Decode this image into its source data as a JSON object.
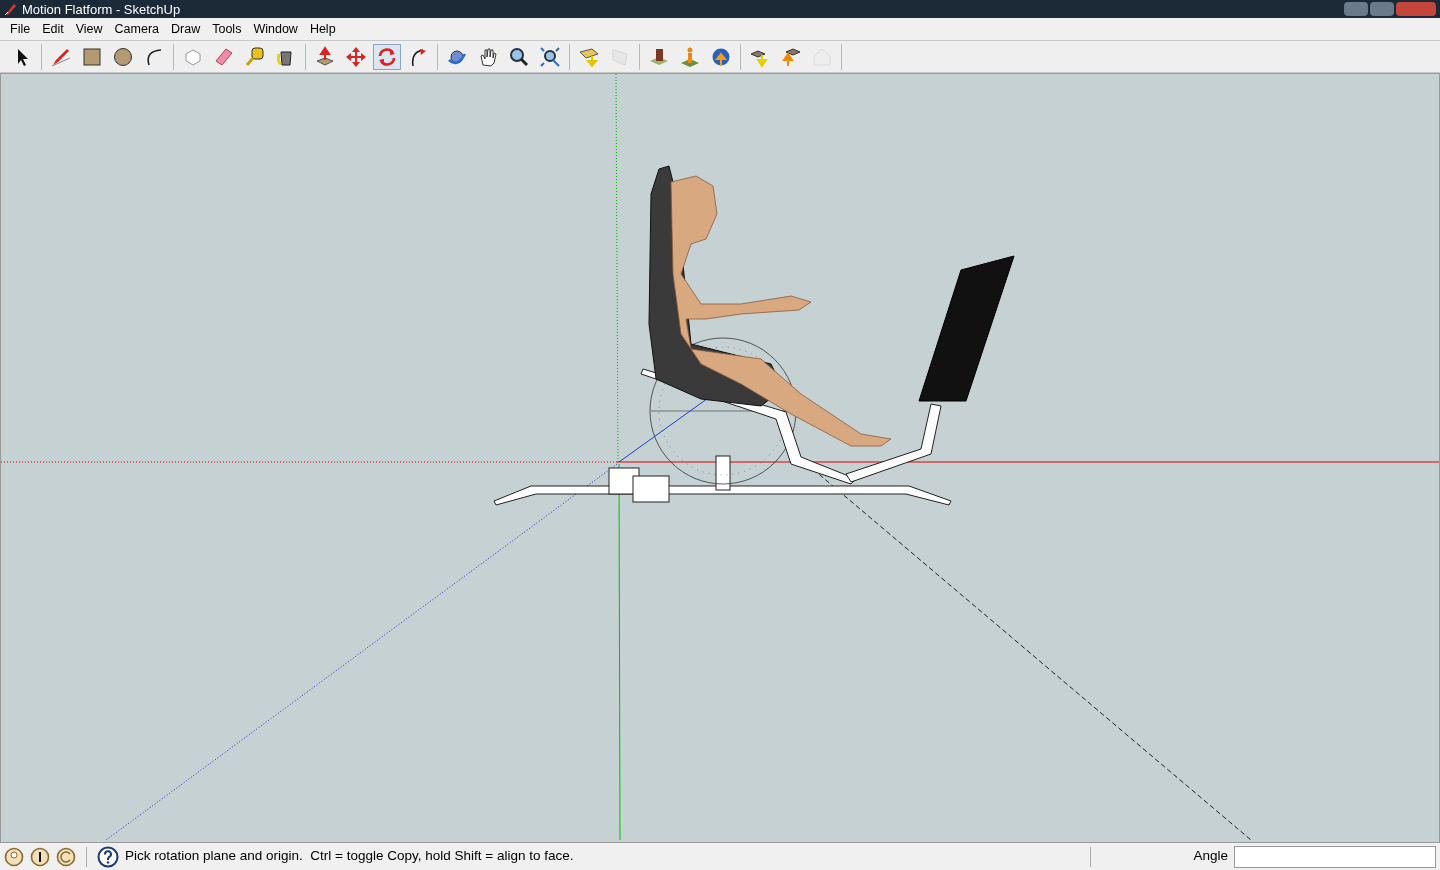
{
  "window": {
    "title": "Motion Flatform - SketchUp"
  },
  "menu": [
    "File",
    "Edit",
    "View",
    "Camera",
    "Draw",
    "Tools",
    "Window",
    "Help"
  ],
  "toolbar": [
    [
      {
        "kind": "select",
        "selected": false,
        "disabled": false
      }
    ],
    [
      {
        "kind": "pencil",
        "selected": false,
        "disabled": false
      },
      {
        "kind": "rectangle",
        "selected": false,
        "disabled": false
      },
      {
        "kind": "circle",
        "selected": false,
        "disabled": false
      },
      {
        "kind": "arc",
        "selected": false,
        "disabled": false
      }
    ],
    [
      {
        "kind": "component",
        "selected": false,
        "disabled": false
      },
      {
        "kind": "eraser",
        "selected": false,
        "disabled": false
      },
      {
        "kind": "tape",
        "selected": false,
        "disabled": false
      },
      {
        "kind": "paint",
        "selected": false,
        "disabled": false
      }
    ],
    [
      {
        "kind": "pushpull",
        "selected": false,
        "disabled": false
      },
      {
        "kind": "move",
        "selected": false,
        "disabled": false
      },
      {
        "kind": "rotate",
        "selected": true,
        "disabled": false
      },
      {
        "kind": "followme",
        "selected": false,
        "disabled": false
      }
    ],
    [
      {
        "kind": "orbit",
        "selected": false,
        "disabled": false
      },
      {
        "kind": "pan",
        "selected": false,
        "disabled": false
      },
      {
        "kind": "zoom",
        "selected": false,
        "disabled": false
      },
      {
        "kind": "extents",
        "selected": false,
        "disabled": false
      }
    ],
    [
      {
        "kind": "terrain",
        "selected": false,
        "disabled": false
      },
      {
        "kind": "photo",
        "selected": false,
        "disabled": true
      }
    ],
    [
      {
        "kind": "building",
        "selected": false,
        "disabled": false
      },
      {
        "kind": "location",
        "selected": false,
        "disabled": false
      },
      {
        "kind": "earth",
        "selected": false,
        "disabled": false
      }
    ],
    [
      {
        "kind": "getmodels",
        "selected": false,
        "disabled": false
      },
      {
        "kind": "share",
        "selected": false,
        "disabled": false
      },
      {
        "kind": "house",
        "selected": false,
        "disabled": true
      }
    ]
  ],
  "status": {
    "message": "Pick rotation plane and origin.  Ctrl = toggle Copy, hold Shift = align to face.",
    "measure_label": "Angle"
  }
}
